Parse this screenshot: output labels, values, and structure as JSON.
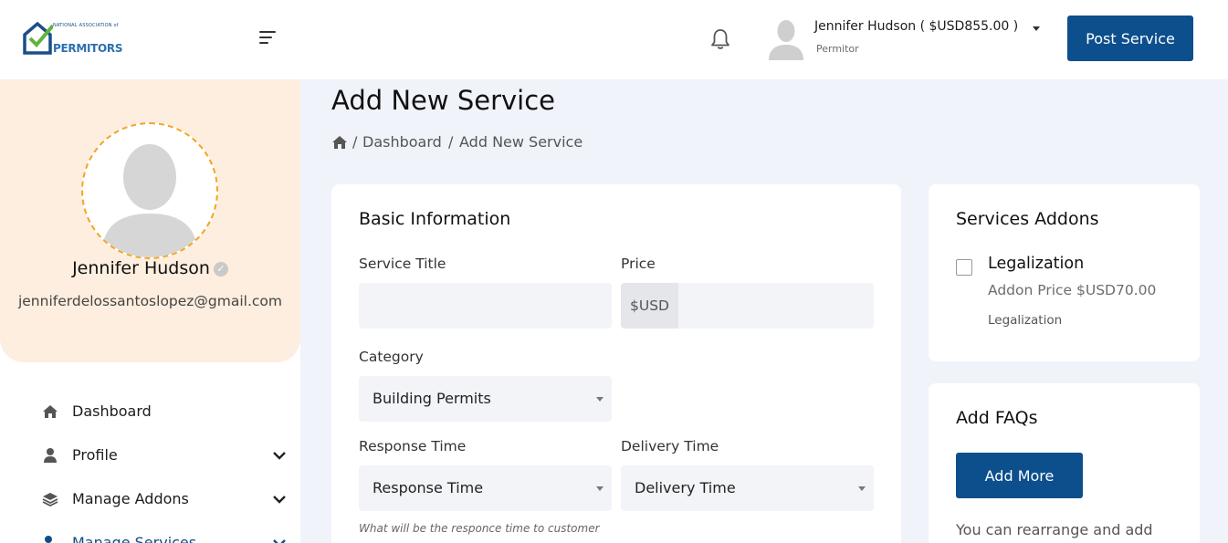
{
  "header": {
    "logo_small": "NATIONAL ASSOCIATION of",
    "logo_big": "PERMITORS",
    "user_name": "Jennifer Hudson ( $USD855.00 )",
    "user_role": "Permitor",
    "post_service_label": "Post Service"
  },
  "sidebar": {
    "profile_name": "Jennifer Hudson",
    "profile_email": "jenniferdelossantoslopez@gmail.com",
    "items": [
      {
        "label": "Dashboard",
        "icon": "home-icon"
      },
      {
        "label": "Profile",
        "icon": "user-icon"
      },
      {
        "label": "Manage Addons",
        "icon": "layers-icon"
      },
      {
        "label": "Manage Services",
        "icon": "user-gear-icon"
      }
    ]
  },
  "page": {
    "title": "Add New Service",
    "breadcrumb_sep1": "/",
    "breadcrumb_dashboard": "Dashboard",
    "breadcrumb_sep2": "/",
    "breadcrumb_current": "Add New Service"
  },
  "basic_info": {
    "title": "Basic Information",
    "service_title_label": "Service Title",
    "service_title_value": "",
    "price_label": "Price",
    "price_prefix": "$USD",
    "price_value": "",
    "category_label": "Category",
    "category_value": "Building Permits",
    "response_time_label": "Response Time",
    "response_time_value": "Response Time",
    "delivery_time_label": "Delivery Time",
    "delivery_time_value": "Delivery Time",
    "response_hint": "What will be the responce time to customer"
  },
  "addons": {
    "title": "Services Addons",
    "item_name": "Legalization",
    "item_price": "Addon Price $USD70.00",
    "item_desc": "Legalization"
  },
  "faqs": {
    "title": "Add FAQs",
    "add_more_label": "Add More",
    "text": "You can rearrange and add"
  },
  "colors": {
    "primary": "#0c4f8c",
    "profile_bg": "#fdeedf",
    "avatar_border": "#f2a622",
    "page_bg": "#f0f3fa"
  }
}
